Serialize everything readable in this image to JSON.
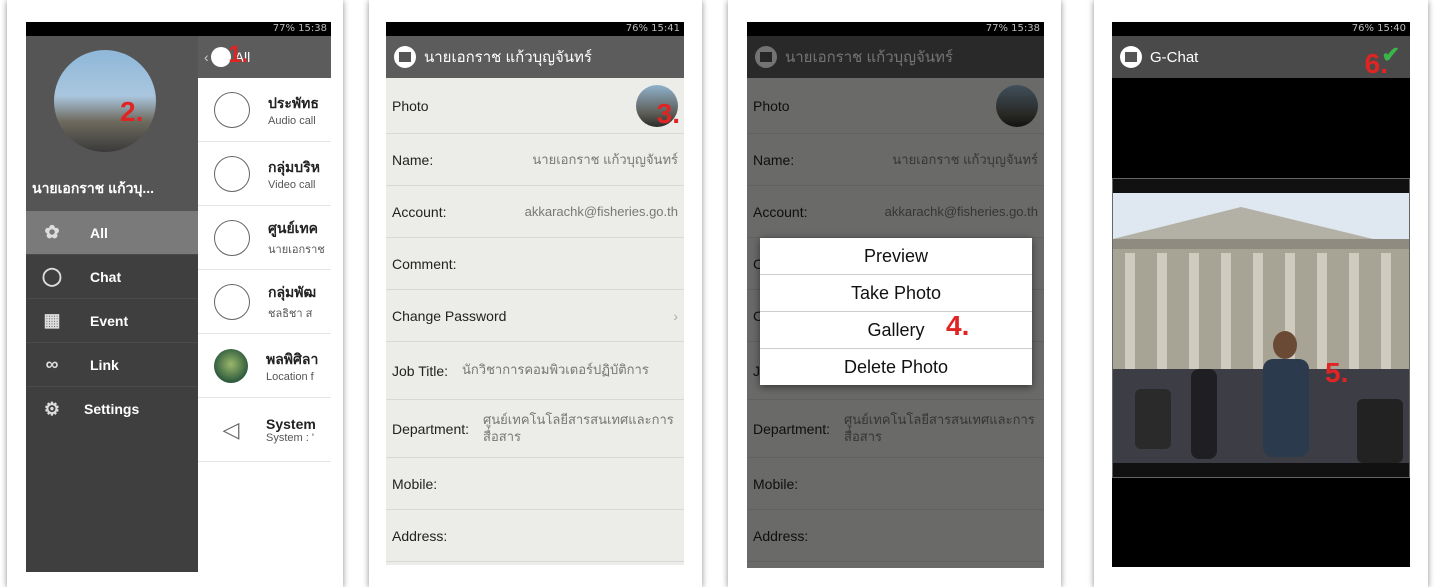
{
  "panel1": {
    "status": "77% 15:38",
    "step": "1.",
    "step_avatar": "2.",
    "user_name": "นายเอกราช แก้วบุ...",
    "list_title": "All",
    "menu": [
      {
        "label": "All",
        "icon": "all-icon"
      },
      {
        "label": "Chat",
        "icon": "chat-icon"
      },
      {
        "label": "Event",
        "icon": "calendar-icon"
      },
      {
        "label": "Link",
        "icon": "link-icon"
      },
      {
        "label": "Settings",
        "icon": "gear-icon"
      }
    ],
    "conversations": [
      {
        "title": "ประพัทธ",
        "subtitle": "Audio call"
      },
      {
        "title": "กลุ่มบริห",
        "subtitle": "Video call"
      },
      {
        "title": "ศูนย์เทค",
        "subtitle": "นายเอกราช"
      },
      {
        "title": "กลุ่มพัฒ",
        "subtitle": "ชลธิชา ส"
      },
      {
        "title": "พลพิศิลา",
        "subtitle": "Location f"
      },
      {
        "title": "System",
        "subtitle": "System : '"
      }
    ]
  },
  "profile": {
    "status": "76% 15:41",
    "status2": "77% 15:38",
    "name_title": "นายเอกราช แก้วบุญจันทร์",
    "step_photo": "3.",
    "fields": {
      "photo": "Photo",
      "name_label": "Name:",
      "name_value": "นายเอกราช แก้วบุญจันทร์",
      "account_label": "Account:",
      "account_value": "akkarachk@fisheries.go.th",
      "comment_label": "Comment:",
      "change_password": "Change Password",
      "job_label": "Job Title:",
      "job_value": "นักวิชาการคอมพิวเตอร์ปฏิบัติการ",
      "dept_label": "Department:",
      "dept_value": "ศูนย์เทคโนโลยีสารสนเทศและการสื่อสาร",
      "mobile_label": "Mobile:",
      "address_label": "Address:"
    }
  },
  "dialog": {
    "step": "4.",
    "options": [
      "Preview",
      "Take Photo",
      "Gallery",
      "Delete Photo"
    ]
  },
  "panel4": {
    "status": "76% 15:40",
    "app_title": "G-Chat",
    "step_crop": "5.",
    "step_confirm": "6."
  }
}
